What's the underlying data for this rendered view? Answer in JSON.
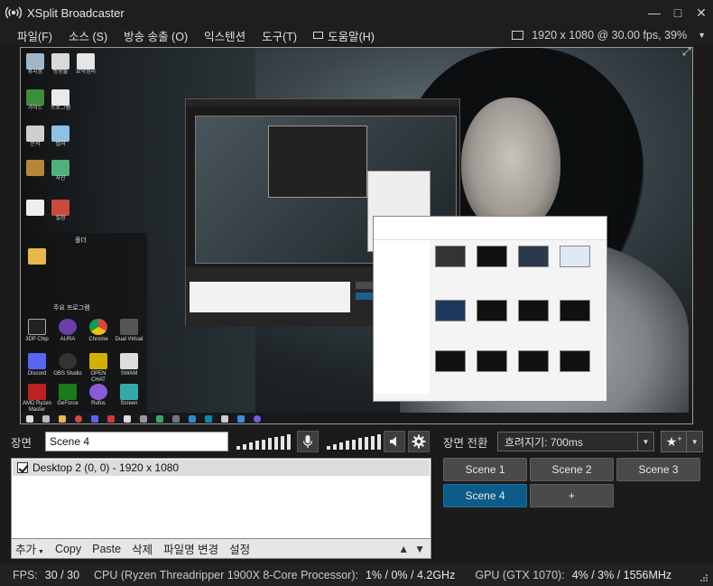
{
  "window": {
    "title": "XSplit Broadcaster",
    "minimize": "—",
    "maximize": "□",
    "close": "✕"
  },
  "menu": {
    "items": [
      "파일(F)",
      "소스 (S)",
      "방송 송출 (O)",
      "익스텐션",
      "도구(T)",
      "도움말(H)"
    ],
    "resolution": "1920 x 1080 @ 30.00 fps, 39%"
  },
  "preview": {
    "desktop_icons": [
      "휴지통",
      "방송툴",
      "요약정리",
      "가이드",
      "프로그램",
      "문서",
      "캡처",
      "사진",
      "설정"
    ],
    "group1_title": "폴더",
    "group2_title": "주요 프로그램",
    "group_icons": [
      "3DP Chip",
      "AURA",
      "Chrome",
      "Dual Virtual",
      "Discord",
      "OBS Studio",
      "OPEN CHAT",
      "SWAM",
      "AMD Ryzen Master",
      "GeForce",
      "Rufus",
      "Screen"
    ]
  },
  "scene": {
    "label": "장면",
    "value": "Scene 4",
    "mic_icon": "microphone-icon",
    "speaker_icon": "speaker-icon",
    "settings_icon": "gear-icon"
  },
  "transition": {
    "label": "장면 전환",
    "value": "흐려지기: 700ms",
    "fav_icon": "star-plus-icon"
  },
  "sources": {
    "items": [
      {
        "checked": true,
        "label": "Desktop 2 (0, 0) - 1920 x 1080"
      }
    ],
    "toolbar": {
      "add": "추가",
      "copy": "Copy",
      "paste": "Paste",
      "delete": "삭제",
      "rename": "파일명 변경",
      "settings": "설정"
    },
    "up": "▲",
    "down": "▼"
  },
  "scenes": {
    "buttons": [
      "Scene 1",
      "Scene 2",
      "Scene 3",
      "Scene 4",
      "+"
    ],
    "active": "Scene 4"
  },
  "status": {
    "fps_label": "FPS:",
    "fps_value": "30 / 30",
    "cpu_label": "CPU (Ryzen Threadripper 1900X 8-Core Processor):",
    "cpu_value": "1% / 0% / 4.2GHz",
    "gpu_label": "GPU (GTX 1070):",
    "gpu_value": "4% / 3% / 1556MHz"
  },
  "colors": {
    "accent": "#0c5b88",
    "bg": "#1b1b1b"
  }
}
